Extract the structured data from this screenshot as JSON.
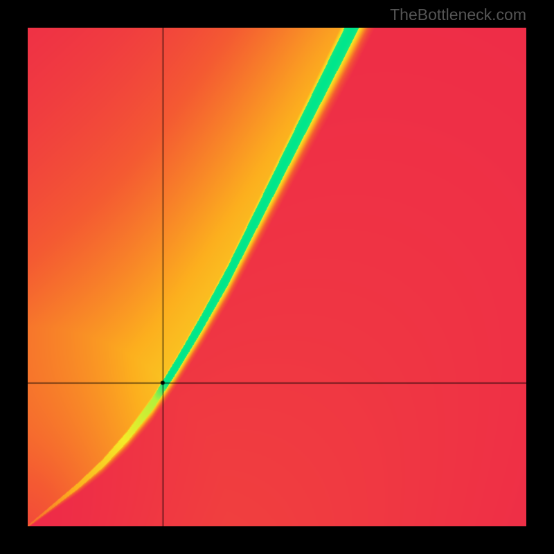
{
  "watermark": "TheBottleneck.com",
  "chart_data": {
    "type": "heatmap",
    "title": "",
    "xlabel": "",
    "ylabel": "",
    "xlim": [
      0,
      1
    ],
    "ylim": [
      0,
      1
    ],
    "crosshair": {
      "x": 0.271,
      "y": 0.713
    },
    "marker": {
      "x": 0.271,
      "y": 0.713,
      "radius": 3,
      "color": "#000000"
    },
    "ridge_path": [
      {
        "x": 0.0,
        "y": 1.0
      },
      {
        "x": 0.05,
        "y": 0.96
      },
      {
        "x": 0.1,
        "y": 0.92
      },
      {
        "x": 0.15,
        "y": 0.875
      },
      {
        "x": 0.2,
        "y": 0.82
      },
      {
        "x": 0.25,
        "y": 0.755
      },
      {
        "x": 0.3,
        "y": 0.675
      },
      {
        "x": 0.35,
        "y": 0.59
      },
      {
        "x": 0.4,
        "y": 0.5
      },
      {
        "x": 0.45,
        "y": 0.4
      },
      {
        "x": 0.5,
        "y": 0.3
      },
      {
        "x": 0.55,
        "y": 0.2
      },
      {
        "x": 0.6,
        "y": 0.1
      },
      {
        "x": 0.65,
        "y": 0.0
      }
    ],
    "ridge_width_start": 0.005,
    "ridge_width_end": 0.1,
    "background_bias": 0.65,
    "colormap": [
      {
        "t": 0.0,
        "r": 237,
        "g": 36,
        "b": 75
      },
      {
        "t": 0.25,
        "r": 244,
        "g": 90,
        "b": 50
      },
      {
        "t": 0.5,
        "r": 252,
        "g": 175,
        "b": 30
      },
      {
        "t": 0.75,
        "r": 245,
        "g": 235,
        "b": 40
      },
      {
        "t": 0.93,
        "r": 180,
        "g": 240,
        "b": 60
      },
      {
        "t": 1.0,
        "r": 0,
        "g": 230,
        "b": 140
      }
    ]
  }
}
